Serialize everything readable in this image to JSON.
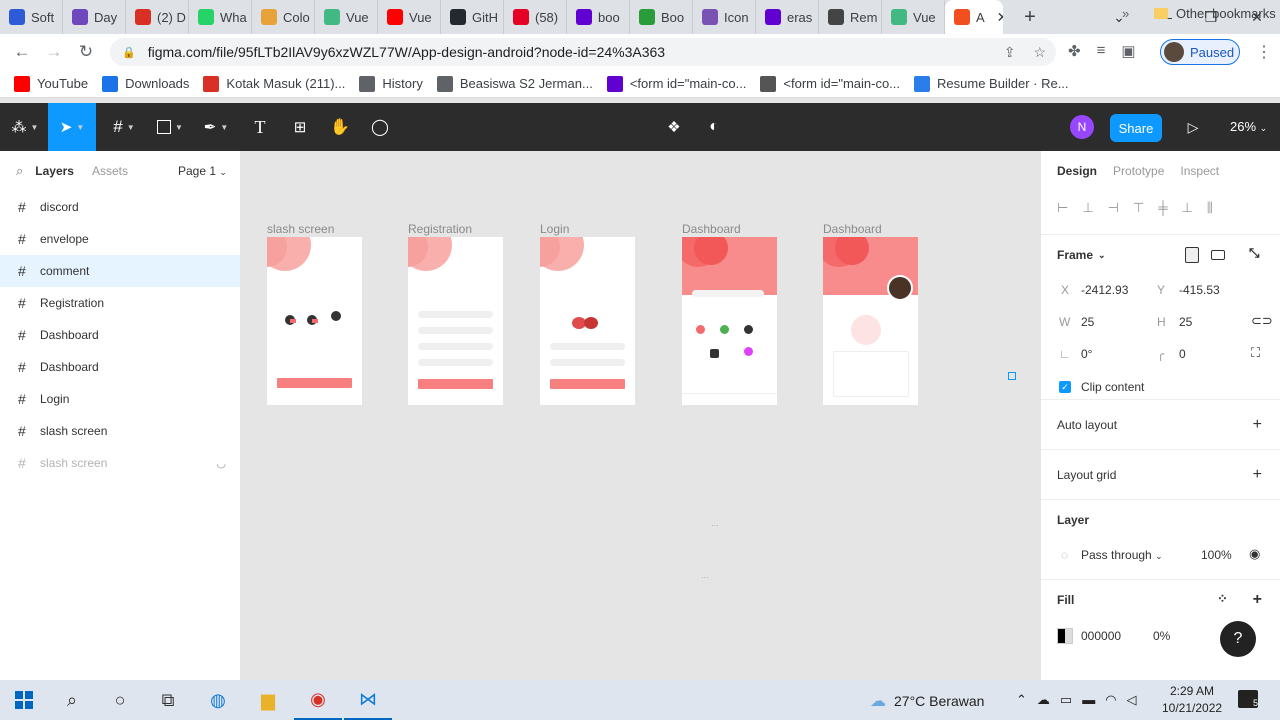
{
  "browser": {
    "tabs": [
      {
        "label": "Soft",
        "icon": "zoom-icon",
        "color": "#2d5bd8"
      },
      {
        "label": "Day",
        "icon": "forms-icon",
        "color": "#7048bd"
      },
      {
        "label": "(2) D",
        "icon": "chrome-account-icon",
        "color": "#d93025"
      },
      {
        "label": "Wha",
        "icon": "whatsapp-icon",
        "color": "#25d366"
      },
      {
        "label": "Colo",
        "icon": "bucket-icon",
        "color": "#e8a23a"
      },
      {
        "label": "Vue",
        "icon": "vue-icon",
        "color": "#42b883"
      },
      {
        "label": "Vue",
        "icon": "youtube-icon",
        "color": "#ff0000"
      },
      {
        "label": "GitH",
        "icon": "github-icon",
        "color": "#24292f"
      },
      {
        "label": "(58)",
        "icon": "pinterest-icon",
        "color": "#e60023"
      },
      {
        "label": "boo",
        "icon": "yahoo-icon",
        "color": "#6001d2"
      },
      {
        "label": "Boo",
        "icon": "w-icon",
        "color": "#2a9d3a"
      },
      {
        "label": "Icon",
        "icon": "bootstrap-icon",
        "color": "#7952b3"
      },
      {
        "label": "eras",
        "icon": "yahoo-icon",
        "color": "#6001d2"
      },
      {
        "label": "Rem",
        "icon": "layers-icon",
        "color": "#444"
      },
      {
        "label": "Vue",
        "icon": "vue-icon",
        "color": "#42b883"
      }
    ],
    "active_tab": {
      "label": "A",
      "icon": "figma-icon"
    },
    "url": "figma.com/file/95fLTb2IlAV9y6xzWZL77W/App-design-android?node-id=24%3A363",
    "profile_status": "Paused",
    "bookmarks": [
      {
        "label": "YouTube",
        "icon": "youtube-icon",
        "color": "#ff0000"
      },
      {
        "label": "Downloads",
        "icon": "download-icon",
        "color": "#1a73e8"
      },
      {
        "label": "Kotak Masuk (211)...",
        "icon": "gmail-icon",
        "color": "#d93025"
      },
      {
        "label": "History",
        "icon": "history-icon",
        "color": "#5f6368"
      },
      {
        "label": "Beasiswa S2 Jerman...",
        "icon": "globe-icon",
        "color": "#5f6368"
      },
      {
        "label": "<form id=\"main-co...",
        "icon": "yahoo-icon",
        "color": "#6001d2"
      },
      {
        "label": "<form id=\"main-co...",
        "icon": "code-icon",
        "color": "#555"
      },
      {
        "label": "Resume Builder · Re...",
        "icon": "resume-icon",
        "color": "#2b7de9"
      }
    ],
    "bookmarks_more": "»",
    "other_bookmarks": "Other bookmarks"
  },
  "figma": {
    "user_initial": "N",
    "share_label": "Share",
    "zoom": "26%",
    "left_tabs": {
      "layers": "Layers",
      "assets": "Assets",
      "page": "Page 1"
    },
    "layers": [
      {
        "name": "discord",
        "state": "normal"
      },
      {
        "name": "envelope",
        "state": "normal"
      },
      {
        "name": "comment",
        "state": "highlight"
      },
      {
        "name": "Registration",
        "state": "normal"
      },
      {
        "name": "Dashboard",
        "state": "normal"
      },
      {
        "name": "Dashboard",
        "state": "normal"
      },
      {
        "name": "Login",
        "state": "normal"
      },
      {
        "name": "slash screen",
        "state": "normal"
      },
      {
        "name": "slash screen",
        "state": "hidden"
      }
    ],
    "frames": [
      {
        "label": "slash screen"
      },
      {
        "label": "Registration"
      },
      {
        "label": "Login"
      },
      {
        "label": "Dashboard"
      },
      {
        "label": "Dashboard"
      }
    ],
    "right_tabs": {
      "design": "Design",
      "prototype": "Prototype",
      "inspect": "Inspect"
    },
    "frame_section": {
      "title": "Frame",
      "x_label": "X",
      "x": "-2412.93",
      "y_label": "Y",
      "y": "-415.53",
      "w_label": "W",
      "w": "25",
      "h_label": "H",
      "h": "25",
      "rotation": "0°",
      "radius": "0",
      "clip_content": "Clip content"
    },
    "auto_layout": "Auto layout",
    "layout_grid": "Layout grid",
    "layer_section": {
      "title": "Layer",
      "blend": "Pass through",
      "opacity": "100%"
    },
    "fill_section": {
      "title": "Fill",
      "hex": "000000",
      "opacity": "0%"
    },
    "help": "?"
  },
  "taskbar": {
    "weather": "27°C Berawan",
    "time": "2:29 AM",
    "date": "10/21/2022",
    "notifications": "5"
  }
}
